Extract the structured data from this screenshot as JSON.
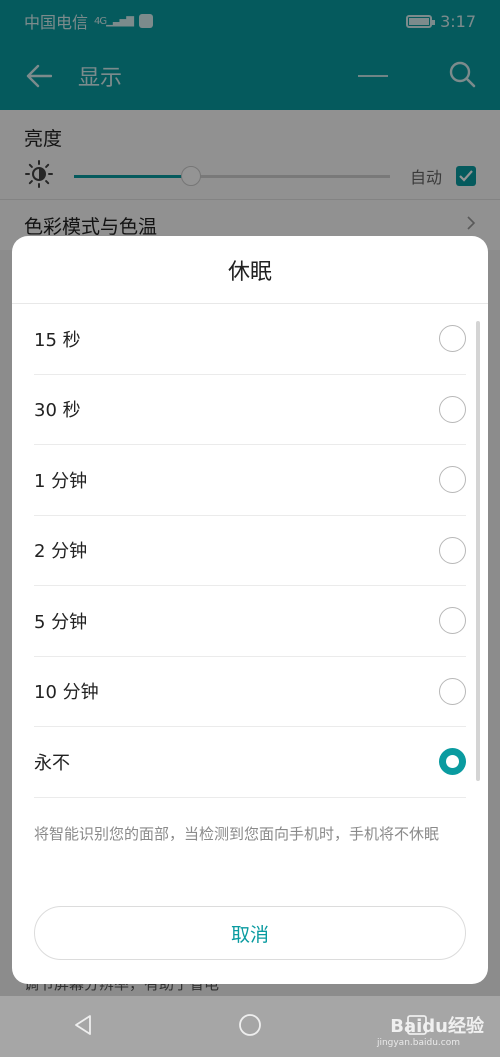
{
  "status_bar": {
    "carrier": "中国电信",
    "network": "4G",
    "time": "3:17"
  },
  "app_bar": {
    "title": "显示"
  },
  "settings": {
    "brightness_label": "亮度",
    "brightness_level": 0.37,
    "auto_label": "自动",
    "auto_checked": true,
    "color_mode_label": "色彩模式与色温"
  },
  "dialog": {
    "title": "休眠",
    "options": [
      {
        "label": "15 秒",
        "selected": false
      },
      {
        "label": "30 秒",
        "selected": false
      },
      {
        "label": "1 分钟",
        "selected": false
      },
      {
        "label": "2 分钟",
        "selected": false
      },
      {
        "label": "5 分钟",
        "selected": false
      },
      {
        "label": "10 分钟",
        "selected": false
      },
      {
        "label": "永不",
        "selected": true
      }
    ],
    "note": "将智能识别您的面部，当检测到您面向手机时，手机将不休眠",
    "cancel_label": "取消"
  },
  "peek_text": "调节屏幕分辨率，有助于省电",
  "watermark": {
    "brand": "Baidu经验",
    "url": "jingyan.baidu.com"
  },
  "colors": {
    "accent": "#0a9ba0"
  }
}
